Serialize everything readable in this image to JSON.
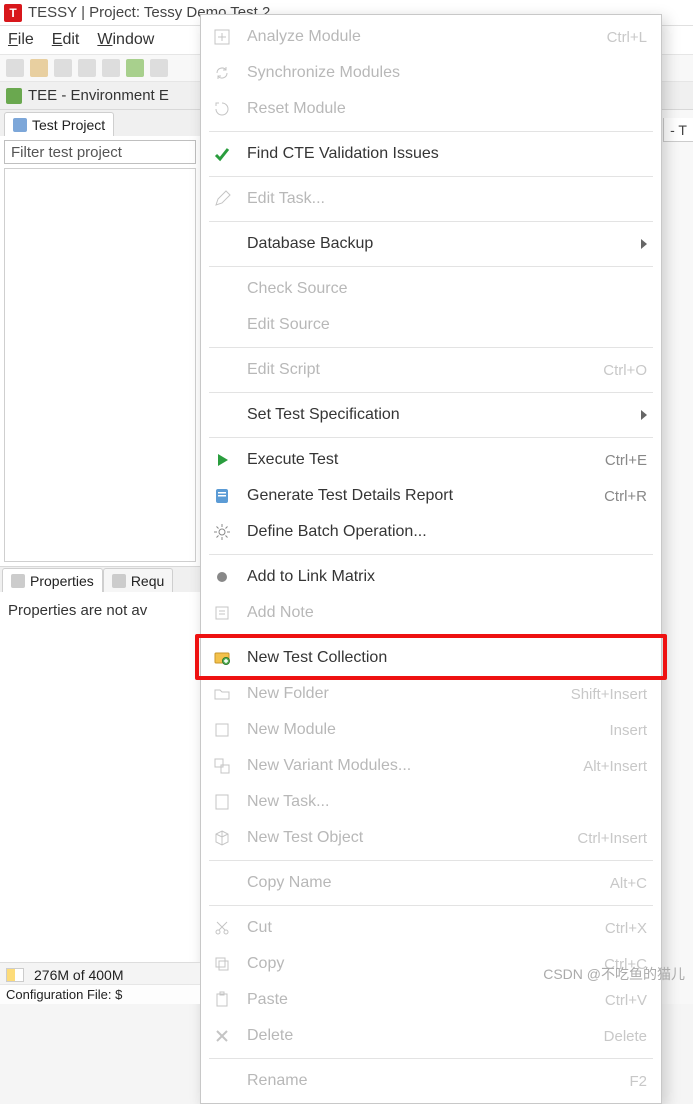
{
  "title_bar": {
    "text": "TESSY | Project: Tessy Demo Test 2"
  },
  "menu_bar": {
    "file": "File",
    "edit": "Edit",
    "window": "Window"
  },
  "view_header": {
    "label": "TEE - Environment E"
  },
  "tabs": {
    "test_project": "Test Project",
    "properties": "Properties",
    "requirements": "Requ"
  },
  "filter": {
    "placeholder": "Filter test project"
  },
  "props_msg": "Properties are not av",
  "right_frag": "- T",
  "status": {
    "mem": "276M of 400M"
  },
  "config": {
    "label": "Configuration File:  $"
  },
  "watermark": "CSDN @不吃鱼的猫儿",
  "ctx": {
    "items": [
      {
        "label": "Analyze Module",
        "shortcut": "Ctrl+L",
        "disabled": true,
        "icon": "analyze"
      },
      {
        "label": "Synchronize Modules",
        "shortcut": "",
        "disabled": true,
        "icon": "sync"
      },
      {
        "label": "Reset Module",
        "shortcut": "",
        "disabled": true,
        "icon": "reset"
      },
      {
        "sep": true
      },
      {
        "label": "Find CTE Validation Issues",
        "shortcut": "",
        "disabled": false,
        "icon": "check"
      },
      {
        "sep": true
      },
      {
        "label": "Edit Task...",
        "shortcut": "",
        "disabled": true,
        "icon": "edit"
      },
      {
        "sep": true
      },
      {
        "label": "Database Backup",
        "shortcut": "",
        "disabled": false,
        "icon": "",
        "submenu": true
      },
      {
        "sep": true
      },
      {
        "label": "Check Source",
        "shortcut": "",
        "disabled": true,
        "icon": ""
      },
      {
        "label": "Edit Source",
        "shortcut": "",
        "disabled": true,
        "icon": ""
      },
      {
        "sep": true
      },
      {
        "label": "Edit Script",
        "shortcut": "Ctrl+O",
        "disabled": true,
        "icon": ""
      },
      {
        "sep": true
      },
      {
        "label": "Set Test Specification",
        "shortcut": "",
        "disabled": false,
        "icon": "",
        "submenu": true
      },
      {
        "sep": true
      },
      {
        "label": "Execute Test",
        "shortcut": "Ctrl+E",
        "disabled": false,
        "icon": "play"
      },
      {
        "label": "Generate Test Details Report",
        "shortcut": "Ctrl+R",
        "disabled": false,
        "icon": "report-blue"
      },
      {
        "label": "Define Batch Operation...",
        "shortcut": "",
        "disabled": false,
        "icon": "gear"
      },
      {
        "sep": true
      },
      {
        "label": "Add to Link Matrix",
        "shortcut": "",
        "disabled": false,
        "icon": "matrix"
      },
      {
        "label": "Add Note",
        "shortcut": "",
        "disabled": true,
        "icon": "note"
      },
      {
        "sep": true
      },
      {
        "label": "New Test Collection",
        "shortcut": "",
        "disabled": false,
        "icon": "collection",
        "highlight": true
      },
      {
        "label": "New Folder",
        "shortcut": "Shift+Insert",
        "disabled": true,
        "icon": "folder"
      },
      {
        "label": "New Module",
        "shortcut": "Insert",
        "disabled": true,
        "icon": "module"
      },
      {
        "label": "New Variant Modules...",
        "shortcut": "Alt+Insert",
        "disabled": true,
        "icon": "variant"
      },
      {
        "label": "New Task...",
        "shortcut": "",
        "disabled": true,
        "icon": "task"
      },
      {
        "label": "New Test Object",
        "shortcut": "Ctrl+Insert",
        "disabled": true,
        "icon": "cube"
      },
      {
        "sep": true
      },
      {
        "label": "Copy Name",
        "shortcut": "Alt+C",
        "disabled": true,
        "icon": ""
      },
      {
        "sep": true
      },
      {
        "label": "Cut",
        "shortcut": "Ctrl+X",
        "disabled": true,
        "icon": "cut"
      },
      {
        "label": "Copy",
        "shortcut": "Ctrl+C",
        "disabled": true,
        "icon": "copy"
      },
      {
        "label": "Paste",
        "shortcut": "Ctrl+V",
        "disabled": true,
        "icon": "paste"
      },
      {
        "label": "Delete",
        "shortcut": "Delete",
        "disabled": true,
        "icon": "delete"
      },
      {
        "sep": true
      },
      {
        "label": "Rename",
        "shortcut": "F2",
        "disabled": true,
        "icon": ""
      }
    ]
  }
}
